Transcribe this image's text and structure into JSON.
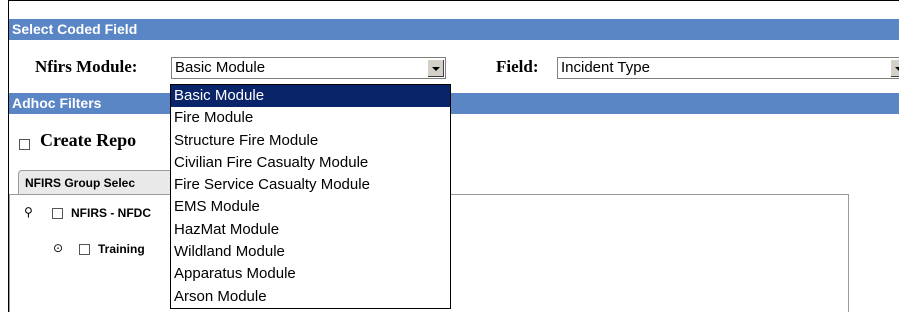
{
  "sections": {
    "select_coded_field": "Select Coded Field",
    "adhoc_filters": "Adhoc Filters"
  },
  "nfirs_module": {
    "label": "Nfirs Module:",
    "value": "Basic Module",
    "options": [
      "Basic Module",
      "Fire Module",
      "Structure Fire Module",
      "Civilian Fire Casualty Module",
      "Fire Service Casualty Module",
      "EMS Module",
      "HazMat Module",
      "Wildland Module",
      "Apparatus Module",
      "Arson Module"
    ],
    "highlighted_index": 0
  },
  "field": {
    "label": "Field:",
    "value": "Incident Type"
  },
  "create_report": {
    "label": "Create Repo"
  },
  "tabs": {
    "group_select": "NFIRS Group Selec"
  },
  "tree": {
    "root_label": "NFIRS - NFDC",
    "child_label": "Training"
  }
}
